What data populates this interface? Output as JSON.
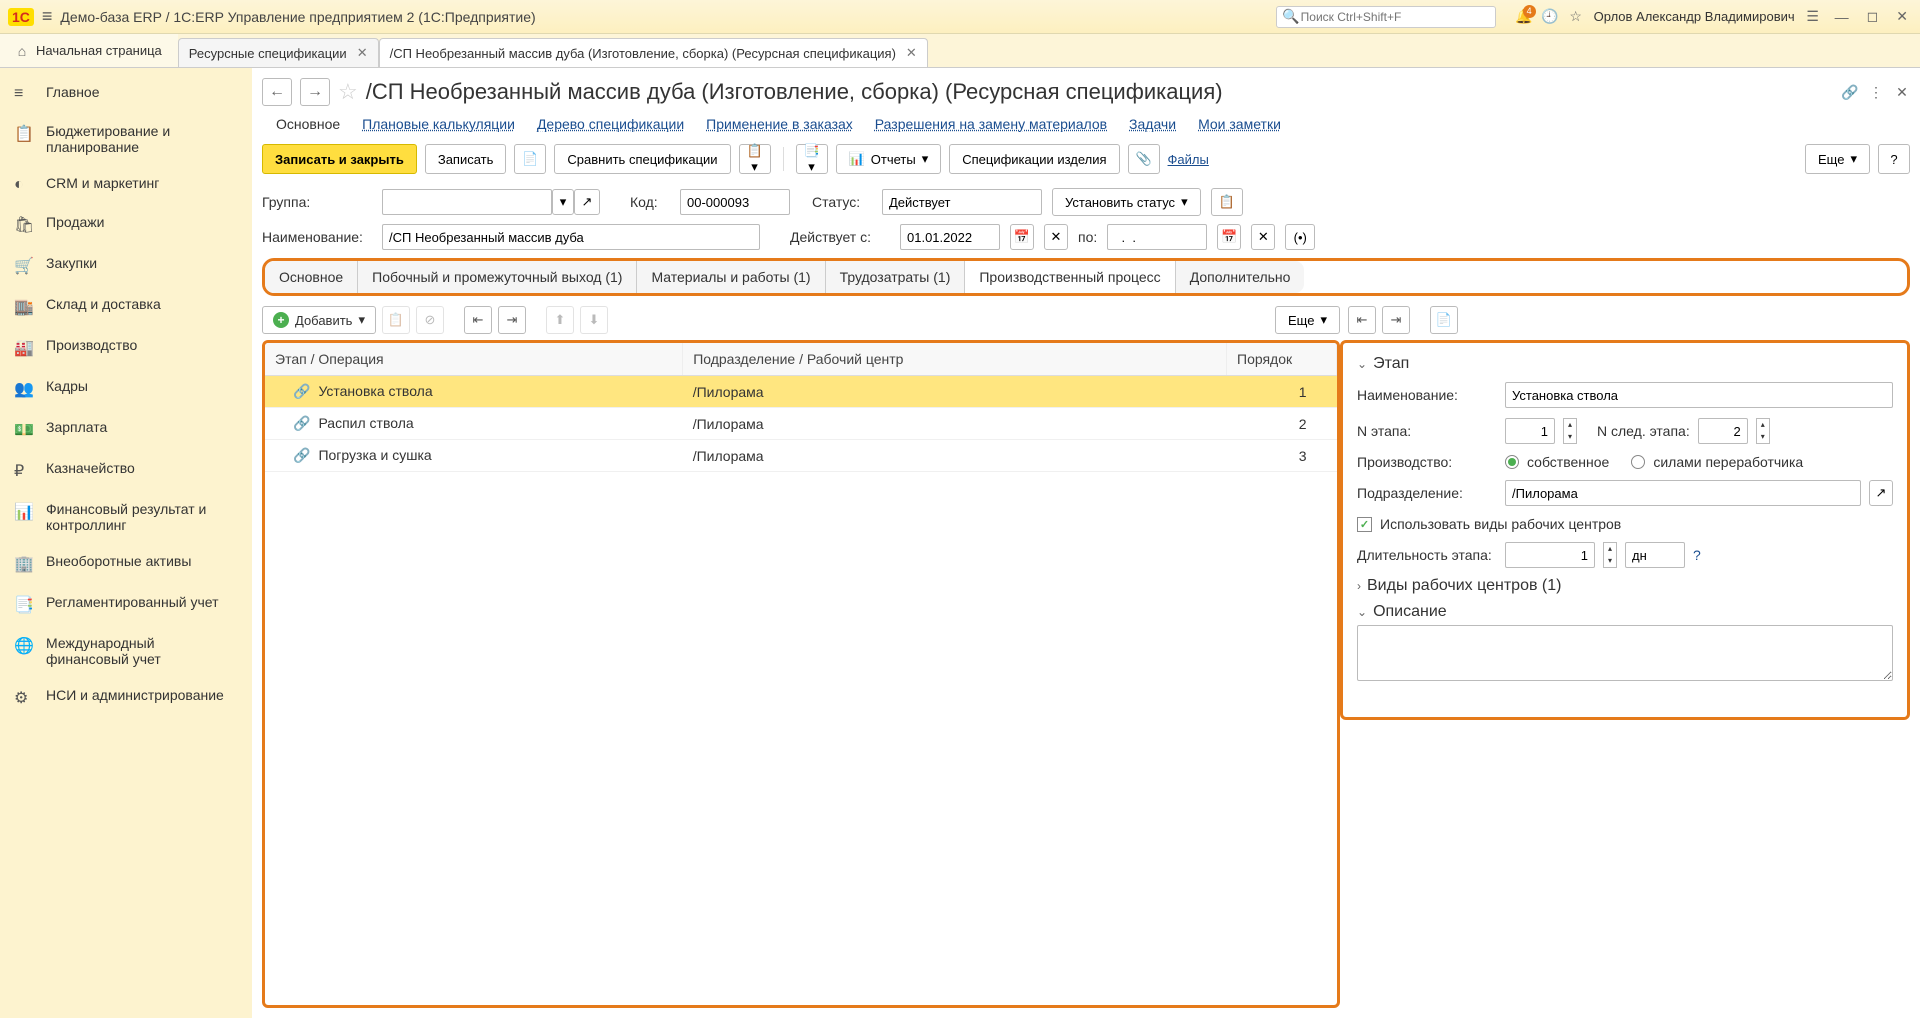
{
  "topbar": {
    "app_title": "Демо-база ERP / 1С:ERP Управление предприятием 2  (1С:Предприятие)",
    "search_placeholder": "Поиск Ctrl+Shift+F",
    "notif_count": "4",
    "username": "Орлов Александр Владимирович"
  },
  "tabs": {
    "home": "Начальная страница",
    "t1": "Ресурсные спецификации",
    "t2": "/СП Необрезанный массив дуба (Изготовление, сборка) (Ресурсная спецификация)"
  },
  "sidebar": [
    {
      "icon": "≡",
      "label": "Главное"
    },
    {
      "icon": "📋",
      "label": "Бюджетирование и планирование"
    },
    {
      "icon": "◐",
      "label": "CRM и маркетинг"
    },
    {
      "icon": "🛍",
      "label": "Продажи"
    },
    {
      "icon": "🛒",
      "label": "Закупки"
    },
    {
      "icon": "🏬",
      "label": "Склад и доставка"
    },
    {
      "icon": "🏭",
      "label": "Производство"
    },
    {
      "icon": "👥",
      "label": "Кадры"
    },
    {
      "icon": "💵",
      "label": "Зарплата"
    },
    {
      "icon": "₽",
      "label": "Казначейство"
    },
    {
      "icon": "📊",
      "label": "Финансовый результат и контроллинг"
    },
    {
      "icon": "🏢",
      "label": "Внеоборотные активы"
    },
    {
      "icon": "📑",
      "label": "Регламентированный учет"
    },
    {
      "icon": "🌐",
      "label": "Международный финансовый учет"
    },
    {
      "icon": "⚙",
      "label": "НСИ и администрирование"
    }
  ],
  "page": {
    "title": "/СП Необрезанный массив дуба (Изготовление, сборка) (Ресурсная спецификация)"
  },
  "subnav": {
    "main": "Основное",
    "plan": "Плановые калькуляции",
    "tree": "Дерево спецификации",
    "apply": "Применение в заказах",
    "repl": "Разрешения на замену материалов",
    "tasks": "Задачи",
    "notes": "Мои заметки"
  },
  "toolbar": {
    "save_close": "Записать и закрыть",
    "save": "Записать",
    "compare": "Сравнить спецификации",
    "reports": "Отчеты",
    "item_specs": "Спецификации изделия",
    "files": "Файлы",
    "more": "Еще"
  },
  "form": {
    "group_label": "Группа:",
    "code_label": "Код:",
    "code_value": "00-000093",
    "status_label": "Статус:",
    "status_value": "Действует",
    "set_status": "Установить статус",
    "name_label": "Наименование:",
    "name_value": "/СП Необрезанный массив дуба",
    "valid_from_label": "Действует с:",
    "valid_from_value": "01.01.2022",
    "to_label": "по:",
    "to_value": "  .  .    "
  },
  "inner_tabs": {
    "t1": "Основное",
    "t2": "Побочный и промежуточный выход (1)",
    "t3": "Материалы и работы (1)",
    "t4": "Трудозатраты (1)",
    "t5": "Производственный процесс",
    "t6": "Дополнительно"
  },
  "list_toolbar": {
    "add": "Добавить",
    "more": "Еще"
  },
  "table": {
    "col1": "Этап / Операция",
    "col2": "Подразделение / Рабочий центр",
    "col3": "Порядок",
    "rows": [
      {
        "name": "Установка ствола",
        "unit": "/Пилорама",
        "order": "1"
      },
      {
        "name": "Распил ствола",
        "unit": "/Пилорама",
        "order": "2"
      },
      {
        "name": "Погрузка и сушка",
        "unit": "/Пилорама",
        "order": "3"
      }
    ]
  },
  "details": {
    "stage_title": "Этап",
    "name_label": "Наименование:",
    "name_value": "Установка ствола",
    "stage_n_label": "N этапа:",
    "stage_n_value": "1",
    "next_n_label": "N след. этапа:",
    "next_n_value": "2",
    "prod_label": "Производство:",
    "prod_own": "собственное",
    "prod_ext": "силами переработчика",
    "unit_label": "Подразделение:",
    "unit_value": "/Пилорама",
    "use_rc": "Использовать виды рабочих центров",
    "dur_label": "Длительность этапа:",
    "dur_value": "1",
    "dur_unit": "дн",
    "rc_types": "Виды рабочих центров (1)",
    "desc": "Описание"
  }
}
